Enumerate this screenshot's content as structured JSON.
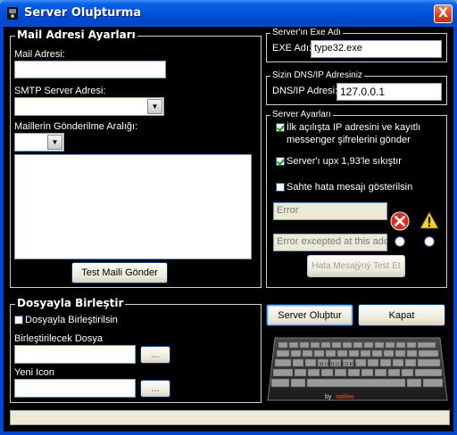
{
  "window": {
    "title": "Server Oluþturma",
    "close_label": "X"
  },
  "mail": {
    "group_title": "Mail Adresi Ayarları",
    "address_label": "Mail Adresi:",
    "address_value": "",
    "smtp_label": "SMTP Server Adresi:",
    "smtp_value": "",
    "interval_label": "Maillerin Gönderilme Aralığı:",
    "interval_value": "",
    "body_value": "",
    "test_button": "Test Maili Gönder"
  },
  "exe": {
    "group_title": "Server'ın Exe Adı",
    "label": "EXE Adı:",
    "value": "type32.exe"
  },
  "dns": {
    "group_title": "Sizin DNS/IP Adresiniz",
    "label": "DNS/IP Adresi:",
    "value": "127.0.0.1"
  },
  "server_settings": {
    "group_title": "Server Ayarları",
    "options": [
      {
        "label": "İlk açılışta IP adresini ve kayıtlı messenger şifrelerini gönder",
        "checked": true
      },
      {
        "label": "Server'ı upx 1,93'le sıkıştır",
        "checked": true
      },
      {
        "label": "Sahte hata mesajı gösterilsin",
        "checked": false
      }
    ],
    "error_title": "Error",
    "error_message": "Error excepted at this addre",
    "error_icon": "error-icon",
    "warning_icon": "warning-icon",
    "test_error_button": "Hata Mesajýný Test Et"
  },
  "combine": {
    "group_title": "Dosyayla Birleştir",
    "enable_label": "Dosyayla Birleştirilsin",
    "enable_checked": false,
    "file_label": "Birleştirilecek Dosya",
    "file_value": "",
    "icon_label": "Yeni Icon",
    "icon_value": "",
    "browse_label": "..."
  },
  "actions": {
    "create": "Server Oluþtur",
    "close": "Kapat"
  },
  "keyboard": {
    "key_text": "M I K R O D O R E",
    "credit_by": "by",
    "credit_name": "nailoo"
  },
  "colors": {
    "titlebar": "#0251d8",
    "client_bg": "#000000",
    "close": "#d8421f"
  }
}
